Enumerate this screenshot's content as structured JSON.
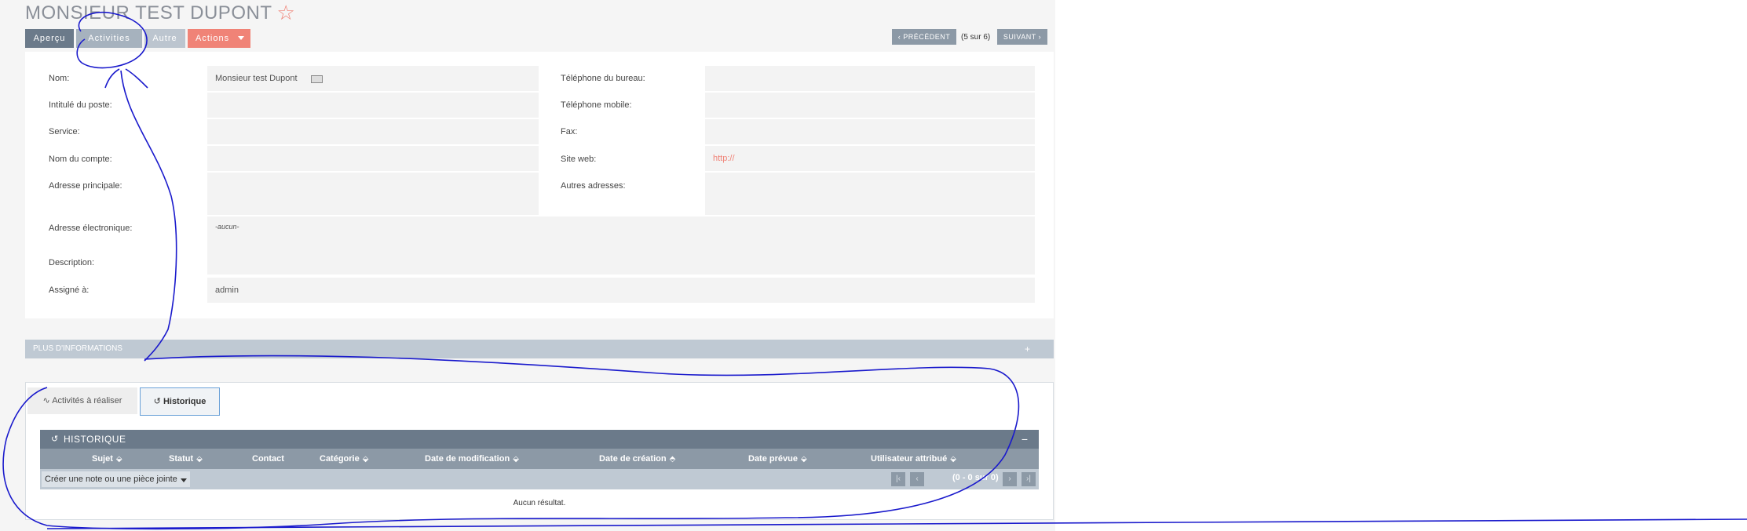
{
  "header": {
    "title": "MONSIEUR TEST DUPONT",
    "star_icon": "star-icon"
  },
  "tabs": [
    {
      "label": "Aperçu"
    },
    {
      "label": "Activities"
    },
    {
      "label": "Autre"
    },
    {
      "label": "Actions"
    }
  ],
  "pager": {
    "prev_label": "PRÉCÉDENT",
    "position": "(5 sur 6)",
    "next_label": "SUIVANT"
  },
  "fields": {
    "nom": {
      "label": "Nom:",
      "value": "Monsieur test Dupont"
    },
    "intitule": {
      "label": "Intitulé du poste:"
    },
    "service": {
      "label": "Service:"
    },
    "compte": {
      "label": "Nom du compte:"
    },
    "adresse": {
      "label": "Adresse principale:"
    },
    "email": {
      "label": "Adresse électronique:",
      "value": "-aucun-"
    },
    "description": {
      "label": "Description:"
    },
    "assigne": {
      "label": "Assigné à:",
      "value": "admin"
    },
    "tel_bureau": {
      "label": "Téléphone du bureau:"
    },
    "tel_mobile": {
      "label": "Téléphone mobile:"
    },
    "fax": {
      "label": "Fax:"
    },
    "site": {
      "label": "Site web:",
      "value": "http://"
    },
    "autres": {
      "label": "Autres adresses:"
    }
  },
  "more_info": {
    "label": "PLUS D'INFORMATIONS",
    "toggle": "+"
  },
  "subpanel": {
    "tabs": [
      {
        "label": "Activités à réaliser"
      },
      {
        "label": "Historique"
      }
    ],
    "title": "HISTORIQUE",
    "collapse": "−",
    "columns": [
      "Sujet",
      "Statut",
      "Contact",
      "Catégorie",
      "Date de modification",
      "Date de création",
      "Date prévue",
      "Utilisateur attribué"
    ],
    "create_label": "Créer une note ou une pièce jointe",
    "count": "(0 - 0 sur 0)",
    "empty": "Aucun résultat."
  },
  "colors": {
    "accent": "#f08377",
    "tab_active": "#6b7a8a",
    "scribble": "#1a1acc"
  }
}
